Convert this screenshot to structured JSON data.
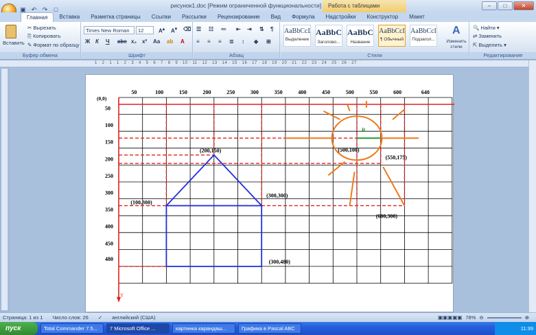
{
  "window": {
    "title": "рисунок1.doc [Режим ограниченной функциональности] - Microsoft Word",
    "context_tab": "Работа с таблицами"
  },
  "tabs": [
    "Главная",
    "Вставка",
    "Разметка страницы",
    "Ссылки",
    "Рассылки",
    "Рецензирование",
    "Вид",
    "Формула",
    "Надстройки",
    "Конструктор",
    "Макет"
  ],
  "ribbon": {
    "clipboard": {
      "paste": "Вставить",
      "cut": "Вырезать",
      "copy": "Копировать",
      "format_painter": "Формат по образцу",
      "label": "Буфер обмена"
    },
    "font": {
      "name": "Times New Roman",
      "size": "12",
      "label": "Шрифт"
    },
    "paragraph": {
      "label": "Абзац"
    },
    "styles": {
      "items": [
        {
          "sample": "AaBbCcL",
          "name": "Выделение"
        },
        {
          "sample": "AaBbC",
          "name": "Заголово..."
        },
        {
          "sample": "AaBbC",
          "name": "Название"
        },
        {
          "sample": "AaBbCcI",
          "name": "¶ Обычный"
        },
        {
          "sample": "AaBbCcI",
          "name": "Подзагол..."
        }
      ],
      "change": "Изменить стили",
      "label": "Стили"
    },
    "editing": {
      "find": "Найти",
      "replace": "Заменить",
      "select": "Выделить",
      "label": "Редактирование"
    }
  },
  "ruler": {
    "text": "1 · 2 · 1 · 1 · 2 · 3 · 4 · 5 · 6 · 7 · 8 · 9 · 10 · 11 · 12 · 13 · 14 · 15 · 16 · 17 · 18 · 19 · 20 · 21 · 22 · 23 · 24 · 25 · 26 · 27"
  },
  "drawing": {
    "origin": "(0,0)",
    "x_ticks": [
      "50",
      "100",
      "150",
      "200",
      "250",
      "300",
      "350",
      "400",
      "450",
      "500",
      "550",
      "600",
      "640"
    ],
    "y_ticks": [
      "50",
      "100",
      "150",
      "200",
      "250",
      "300",
      "350",
      "400",
      "450",
      "480"
    ],
    "x_label": "X",
    "y_label": "Y",
    "labels": {
      "roof_top": "(200,150)",
      "house_left": "(100,300)",
      "house_right": "(300,300)",
      "house_bottom": "(300,480)",
      "sun_center": "(500,100)",
      "sun_bottom": "(550,175)",
      "ray_end": "(600,300)",
      "radius": "R"
    },
    "colors": {
      "axis": "#e02020",
      "house": "#1f2fd8",
      "sun": "#ee7a1a",
      "radius": "#1e9a2a",
      "guide": "#e02020"
    }
  },
  "status": {
    "page": "Страница: 1 из 1",
    "words": "Число слов: 26",
    "lang": "английский (США)",
    "zoom": "78%"
  },
  "taskbar": {
    "start": "пуск",
    "tasks": [
      "Total Commander 7.5...",
      "7 Microsoft Office ...",
      "картинка карандаш...",
      "Графика в Pascal ABC"
    ],
    "clock": "11:39"
  }
}
